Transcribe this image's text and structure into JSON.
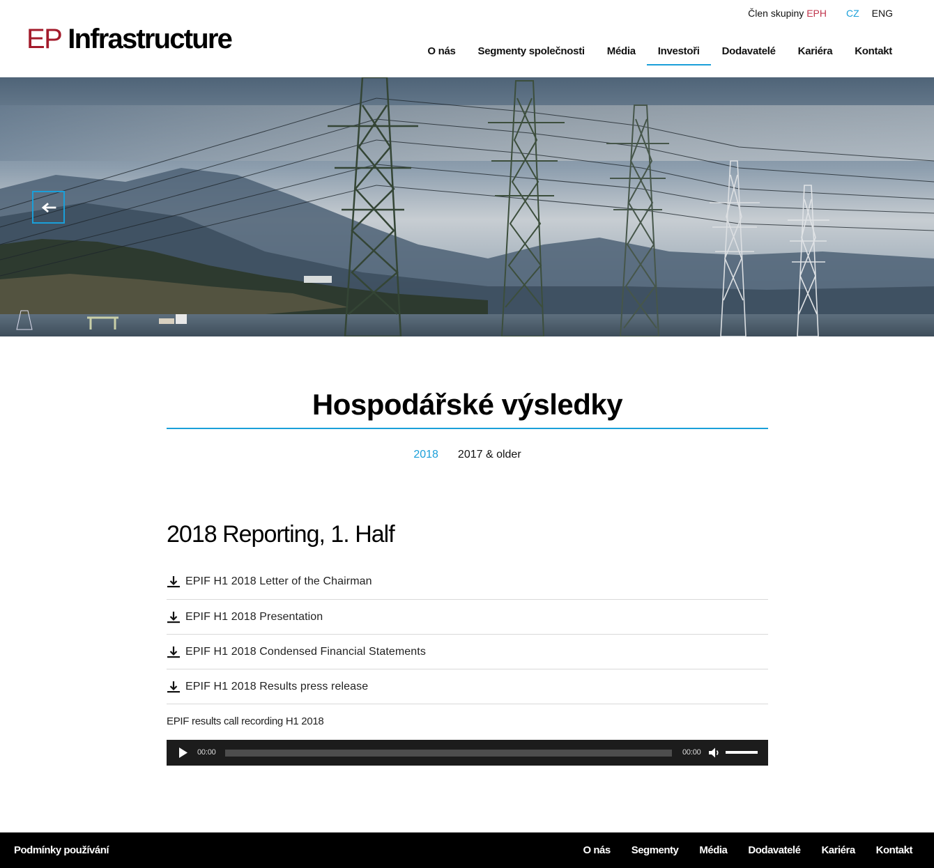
{
  "header": {
    "logo_ep": "EP",
    "logo_infra": "Infrastructure",
    "member_text": "Člen skupiny",
    "member_brand": "EPH",
    "lang_cz": "CZ",
    "lang_en": "ENG",
    "nav": [
      {
        "label": "O nás"
      },
      {
        "label": "Segmenty společnosti"
      },
      {
        "label": "Média"
      },
      {
        "label": "Investoři",
        "active": true
      },
      {
        "label": "Dodavatelé"
      },
      {
        "label": "Kariéra"
      },
      {
        "label": "Kontakt"
      }
    ]
  },
  "hero": {
    "back_icon": "arrow-left-icon"
  },
  "main": {
    "title": "Hospodářské výsledky",
    "year_tabs": [
      {
        "label": "2018",
        "active": true
      },
      {
        "label": "2017 & older"
      }
    ],
    "section_title": "2018 Reporting, 1. Half",
    "documents": [
      {
        "label": "EPIF H1 2018 Letter of the Chairman",
        "icon": "download-icon"
      },
      {
        "label": "EPIF H1 2018 Presentation",
        "icon": "download-icon"
      },
      {
        "label": "EPIF H1 2018 Condensed Financial Statements",
        "icon": "download-icon"
      },
      {
        "label": "EPIF H1 2018 Results press release",
        "icon": "download-icon"
      }
    ],
    "recording_label": "EPIF results call recording H1 2018",
    "audio": {
      "current_time": "00:00",
      "duration": "00:00",
      "progress": 0,
      "volume": 1.0
    }
  },
  "footer": {
    "terms": "Podmínky používání",
    "links": [
      {
        "label": "O nás"
      },
      {
        "label": "Segmenty"
      },
      {
        "label": "Média"
      },
      {
        "label": "Dodavatelé"
      },
      {
        "label": "Kariéra"
      },
      {
        "label": "Kontakt"
      }
    ]
  },
  "colors": {
    "accent": "#1a9fd9",
    "brand_red": "#a31b2b",
    "footer_bg": "#000000",
    "player_bg": "#1c1c1c"
  }
}
